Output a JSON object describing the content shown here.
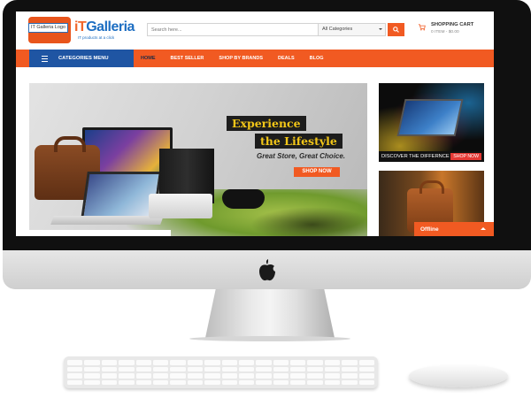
{
  "header": {
    "logo_alt": "IT Galleria Logo",
    "brand_name": "Galleria",
    "brand_prefix": "iT",
    "brand_tagline": "IT products at a click",
    "search_placeholder": "Search here...",
    "category_select": "All Categories",
    "cart_title": "SHOPPING CART",
    "cart_summary": "0 ITEM - $0.00"
  },
  "nav": {
    "categories_menu": "CATEGORIES MENU",
    "items": [
      "HOME",
      "BEST SELLER",
      "SHOP BY BRANDS",
      "DEALS",
      "BLOG"
    ],
    "active_index": 0
  },
  "hero": {
    "headline_1": "Experience",
    "headline_2": "the Lifestyle",
    "tagline": "Great Store, Great Choice.",
    "cta": "SHOP NOW"
  },
  "side_banner": {
    "caption": "DISCOVER THE DIFFERNCE",
    "button": "SHOP NOW"
  },
  "chat": {
    "status": "Offline"
  },
  "colors": {
    "accent": "#f15a22",
    "nav_blue": "#1f55a3",
    "brand_blue": "#1d6ec2"
  }
}
